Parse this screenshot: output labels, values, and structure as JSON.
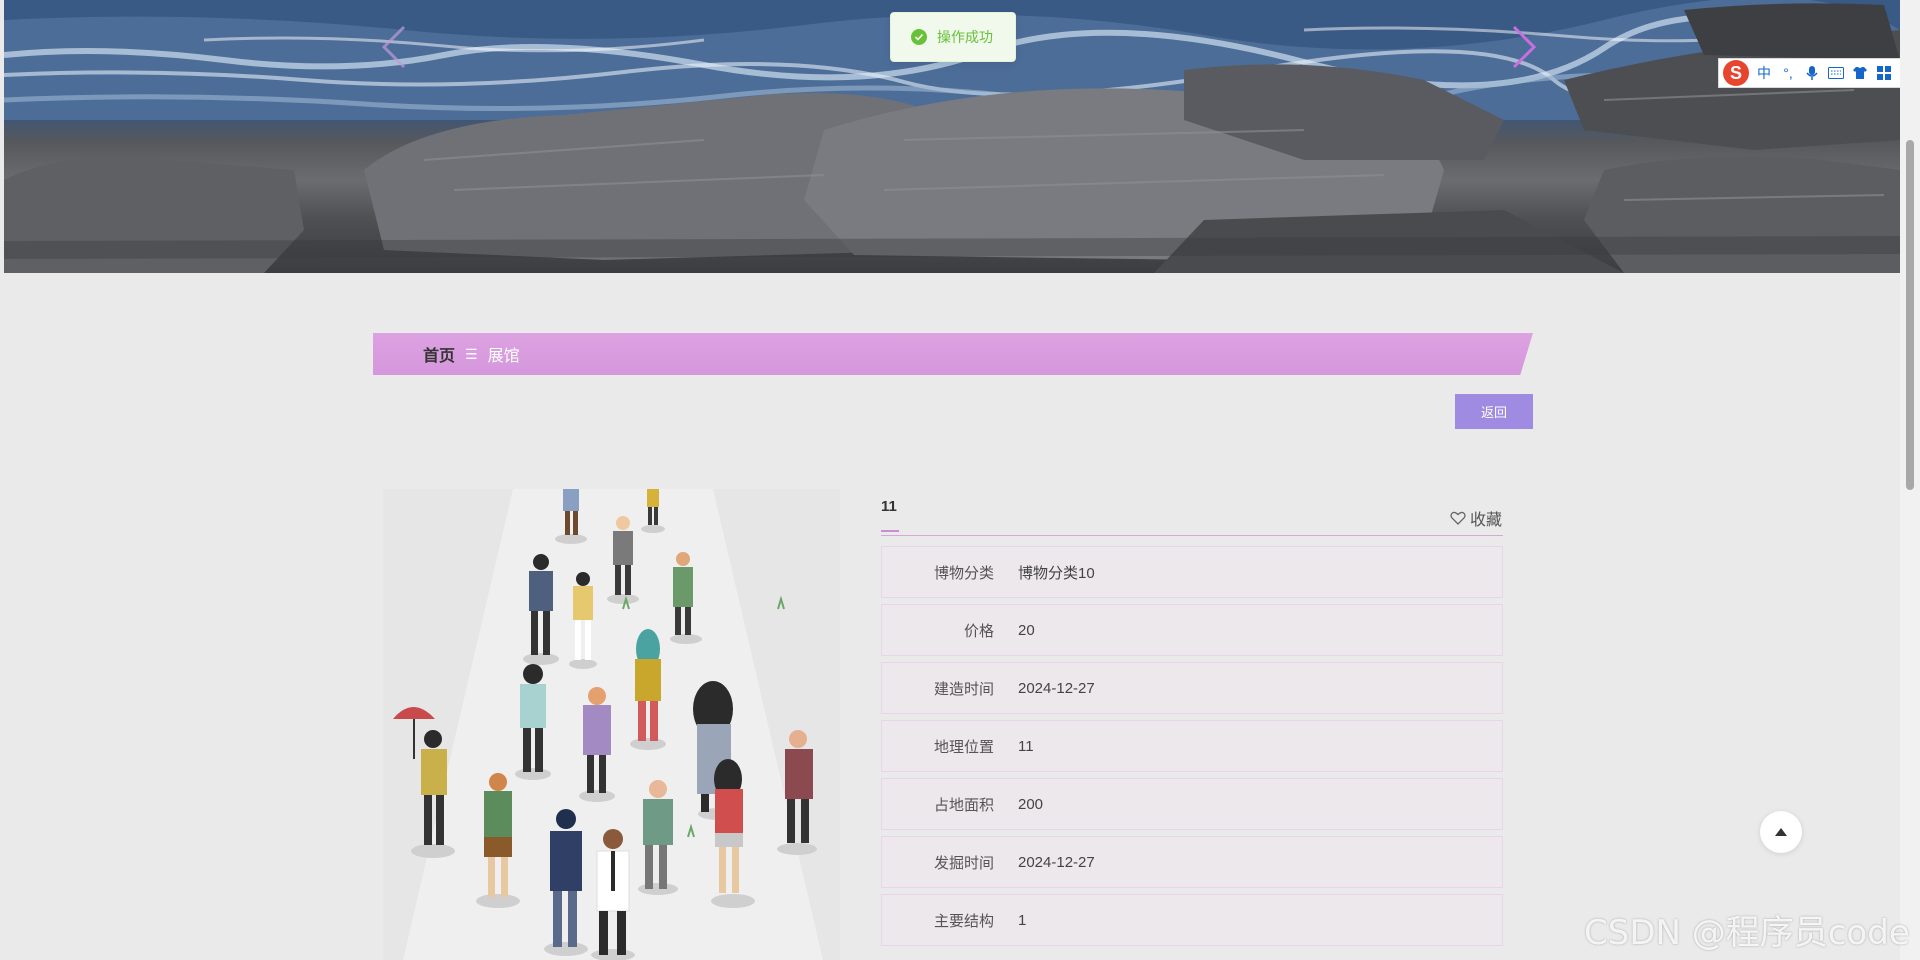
{
  "toast": {
    "message": "操作成功"
  },
  "breadcrumb": {
    "home": "首页",
    "separator": "☰",
    "current": "展馆"
  },
  "back_button": {
    "label": "返回"
  },
  "detail": {
    "title": "11",
    "favorite_label": "收藏",
    "fields": [
      {
        "label": "博物分类",
        "value": "博物分类10"
      },
      {
        "label": "价格",
        "value": "20"
      },
      {
        "label": "建造时间",
        "value": "2024-12-27"
      },
      {
        "label": "地理位置",
        "value": "11"
      },
      {
        "label": "占地面积",
        "value": "200"
      },
      {
        "label": "发掘时间",
        "value": "2024-12-27"
      },
      {
        "label": "主要结构",
        "value": "1"
      }
    ]
  },
  "ime_toolbar": {
    "logo": "S",
    "mode": "中",
    "punct": "°,"
  },
  "watermark": "CSDN @程序员code",
  "colors": {
    "breadcrumb_bg": "#d89cdf",
    "button_bg": "#9f8ce2",
    "toast_text": "#67c23a",
    "row_bg": "#ede8ec"
  }
}
